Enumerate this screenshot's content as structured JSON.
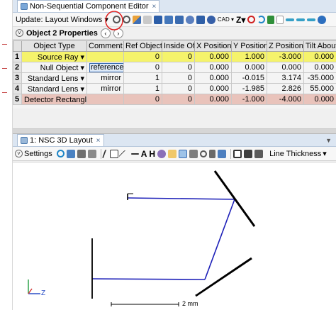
{
  "editor_tab": {
    "title": "Non-Sequential Component Editor",
    "close": "×"
  },
  "toolbar": {
    "update_label": "Update: Layout Windows",
    "cad_label": "CAD",
    "z_label": "Z"
  },
  "property_bar": {
    "label": "Object  2 Properties"
  },
  "table": {
    "headers": [
      "",
      "Object Type",
      "Comment",
      "Ref Object",
      "Inside Of",
      "X Position",
      "Y Position",
      "Z Position",
      "Tilt About X"
    ],
    "rows": [
      {
        "n": "1",
        "type": "Source Ray",
        "comment": "",
        "ref": "0",
        "inside": "0",
        "x": "0.000",
        "y": "1.000",
        "z": "-3.000",
        "tilt": "0.000"
      },
      {
        "n": "2",
        "type": "Null Object",
        "comment": "reference",
        "ref": "0",
        "inside": "0",
        "x": "0.000",
        "y": "0.000",
        "z": "0.000",
        "tilt": "0.000"
      },
      {
        "n": "3",
        "type": "Standard Lens",
        "comment": "mirror",
        "ref": "1",
        "inside": "0",
        "x": "0.000",
        "y": "-0.015",
        "z": "3.174",
        "tilt": "-35.000"
      },
      {
        "n": "4",
        "type": "Standard Lens",
        "comment": "mirror",
        "ref": "1",
        "inside": "0",
        "x": "0.000",
        "y": "-1.985",
        "z": "2.826",
        "tilt": "55.000"
      },
      {
        "n": "5",
        "type": "Detector Rectangle",
        "comment": "",
        "ref": "0",
        "inside": "0",
        "x": "0.000",
        "y": "-1.000",
        "z": "-4.000",
        "tilt": "0.000"
      }
    ]
  },
  "layout_tab": {
    "title": "1: NSC 3D Layout",
    "close": "×"
  },
  "layout_toolbar": {
    "settings_label": "Settings",
    "line_thickness_label": "Line Thickness"
  },
  "viewport": {
    "scale_label": "2 mm",
    "axis_label": "Z"
  },
  "colors": {
    "ray": "#1c1fb8",
    "selected_row": "#f5f36b",
    "detector_row": "#e9c3bb",
    "annotation": "#e02020"
  }
}
